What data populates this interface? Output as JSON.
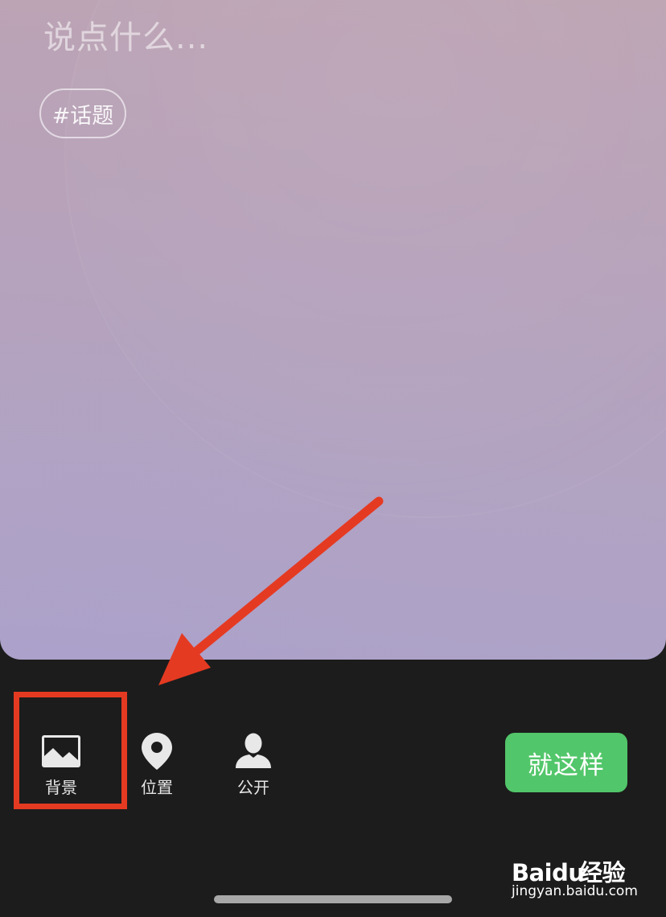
{
  "post": {
    "placeholder": "说点什么...",
    "topic_chip": "#话题"
  },
  "toolbar": {
    "background_label": "背景",
    "location_label": "位置",
    "visibility_label": "公开",
    "done_label": "就这样"
  },
  "icons": {
    "background": "image-icon",
    "location": "location-pin-icon",
    "visibility": "person-icon"
  },
  "watermark": {
    "brand": "Bai",
    "brand_du": "du",
    "brand_suffix": "经验",
    "url": "jingyan.baidu.com"
  },
  "colors": {
    "done_button": "#52c66a",
    "annotation": "#e53a22",
    "toolbar_bg": "#1c1c1c"
  }
}
